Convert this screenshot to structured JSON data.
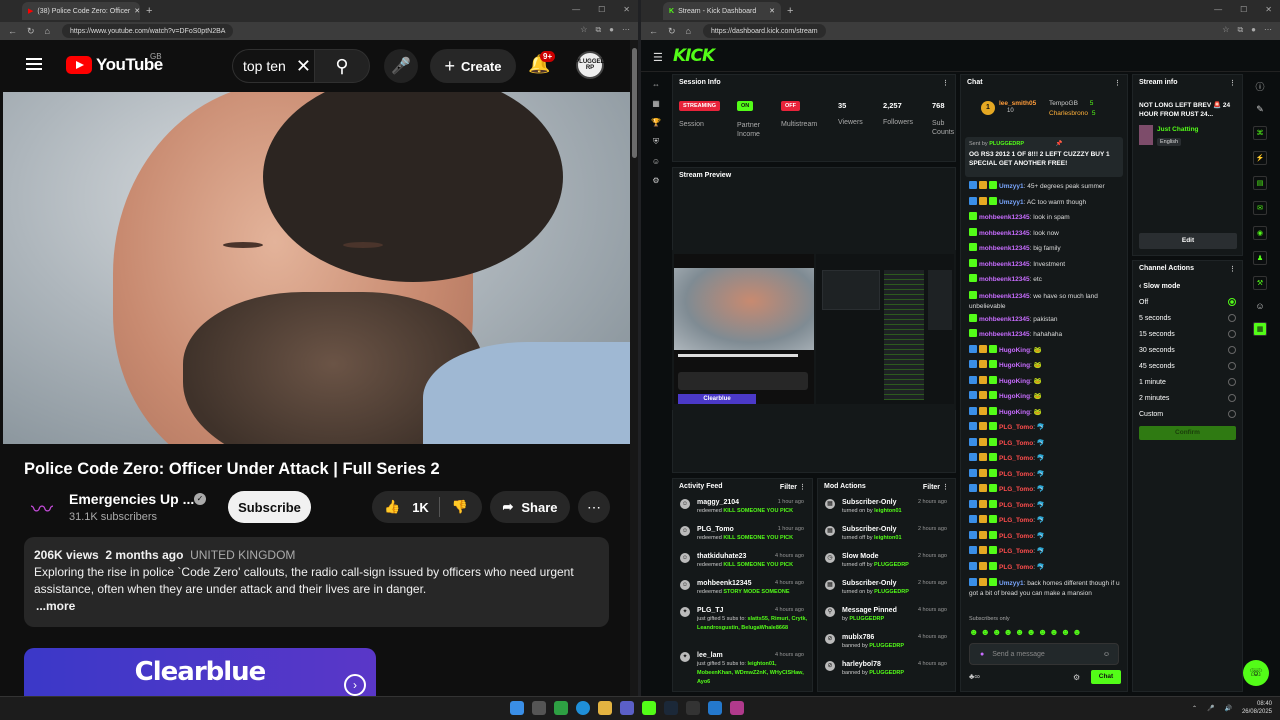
{
  "youtube": {
    "tab_title": "(38) Police Code Zero: Officer",
    "url": "https://www.youtube.com/watch?v=DFoS0ptN2BA",
    "logo": "YouTube",
    "region": "GB",
    "search_value": "top ten",
    "create_label": "Create",
    "notif_badge": "9+",
    "avatar_text": "PLUGGED RP",
    "video_title": "Police Code Zero: Officer Under Attack | Full Series 2",
    "channel_name": "Emergencies Up ...",
    "subscribers": "31.1K subscribers",
    "subscribe_label": "Subscribe",
    "likes": "1K",
    "share_label": "Share",
    "views": "206K views",
    "age": "2 months ago",
    "country": "UNITED KINGDOM",
    "description": "Exploring the rise in police `Code Zero' callouts, the radio call-sign issued by officers who need urgent assistance, often when they are under attack and their lives are in danger.",
    "more_label": "...more",
    "ad_brand": "Clearblue"
  },
  "kick": {
    "tab_title": "Stream - Kick Dashboard",
    "url": "https://dashboard.kick.com/stream",
    "logo": "KICK",
    "session": {
      "title": "Session Info",
      "stats": [
        {
          "value": "STREAMING",
          "label": "Session"
        },
        {
          "value": "ON",
          "label": "Partner Income"
        },
        {
          "value": "OFF",
          "label": "Multistream"
        },
        {
          "value": "35",
          "label": "Viewers"
        },
        {
          "value": "2,257",
          "label": "Followers"
        },
        {
          "value": "768",
          "label": "Sub Counts"
        }
      ]
    },
    "preview_title": "Stream Preview",
    "preview_ad": "Clearblue",
    "activity": {
      "title": "Activity Feed",
      "filter": "Filter",
      "items": [
        {
          "user": "maggy_2104",
          "time": "1 hour ago",
          "text": "redeemed",
          "hl": "KILL SOMEONE YOU PICK"
        },
        {
          "user": "PLG_Tomo",
          "time": "1 hour ago",
          "text": "redeemed",
          "hl": "KILL SOMEONE YOU PICK"
        },
        {
          "user": "thatkiduhate23",
          "time": "4 hours ago",
          "text": "redeemed",
          "hl": "KILL SOMEONE YOU PICK"
        },
        {
          "user": "mohbeenk12345",
          "time": "4 hours ago",
          "text": "redeemed",
          "hl": "STORY MODE SOMEONE"
        },
        {
          "user": "PLG_TJ",
          "time": "4 hours ago",
          "text": "just gifted 5 subs to:",
          "hl": "slatts55, Rimuri, Crytk, Leandrosgustin, BelugaWhale8668"
        },
        {
          "user": "lee_lam",
          "time": "4 hours ago",
          "text": "just gifted 5 subs to:",
          "hl": "leighton01, MobeenKhan, WDmwZ2nK, WHyCISHaw, Ayo6"
        }
      ]
    },
    "mod": {
      "title": "Mod Actions",
      "filter": "Filter",
      "items": [
        {
          "user": "Subscriber-Only",
          "time": "2 hours ago",
          "text": "turned on by",
          "hl": "leighton01"
        },
        {
          "user": "Subscriber-Only",
          "time": "2 hours ago",
          "text": "turned off by",
          "hl": "leighton01"
        },
        {
          "user": "Slow Mode",
          "time": "2 hours ago",
          "text": "turned off by",
          "hl": "PLUGGEDRP"
        },
        {
          "user": "Subscriber-Only",
          "time": "2 hours ago",
          "text": "turned on by",
          "hl": "PLUGGEDRP"
        },
        {
          "user": "Message Pinned",
          "time": "4 hours ago",
          "text": "by",
          "hl": "PLUGGEDRP"
        },
        {
          "user": "mublx786",
          "time": "4 hours ago",
          "text": "banned by",
          "hl": "PLUGGEDRP"
        },
        {
          "user": "harleybol78",
          "time": "4 hours ago",
          "text": "banned by",
          "hl": "PLUGGEDRP"
        }
      ]
    },
    "chat": {
      "title": "Chat",
      "top_user": "lee_smith05",
      "top_count": "10",
      "gifters": [
        {
          "name": "TempoGB",
          "count": "5"
        },
        {
          "name": "Charlesbrono",
          "count": "5"
        }
      ],
      "pinned_by": "Sent by",
      "pinned_user": "PLUGGEDRP",
      "pinned_msg": "OG RS3 2012 1 OF 8!!! 2 LEFT CUZZZY BUY 1 SPECIAL GET ANOTHER FREE!",
      "messages": [
        {
          "user": "Umzyy1",
          "msg": "45+ degrees peak summer",
          "color": "#7aa7ff"
        },
        {
          "user": "Umzyy1",
          "msg": "AC too warm though",
          "color": "#7aa7ff"
        },
        {
          "user": "mohbeenk12345",
          "msg": "look in spam",
          "color": "#c86cff"
        },
        {
          "user": "mohbeenk12345",
          "msg": "look now",
          "color": "#c86cff"
        },
        {
          "user": "mohbeenk12345",
          "msg": "big family",
          "color": "#c86cff"
        },
        {
          "user": "mohbeenk12345",
          "msg": "Investment",
          "color": "#c86cff"
        },
        {
          "user": "mohbeenk12345",
          "msg": "etc",
          "color": "#c86cff"
        },
        {
          "user": "mohbeenk12345",
          "msg": "we have so much land unbelievable",
          "color": "#c86cff"
        },
        {
          "user": "mohbeenk12345",
          "msg": "pakistan",
          "color": "#c86cff"
        },
        {
          "user": "mohbeenk12345",
          "msg": "hahahaha",
          "color": "#c86cff"
        },
        {
          "user": "HugoKing",
          "msg": "🐸",
          "color": "#c86cff"
        },
        {
          "user": "HugoKing",
          "msg": "🐸",
          "color": "#c86cff"
        },
        {
          "user": "HugoKing",
          "msg": "🐸",
          "color": "#c86cff"
        },
        {
          "user": "HugoKing",
          "msg": "🐸",
          "color": "#c86cff"
        },
        {
          "user": "HugoKing",
          "msg": "🐸",
          "color": "#c86cff"
        },
        {
          "user": "PLG_Tomo",
          "msg": "🐬",
          "color": "#ff4d4d"
        },
        {
          "user": "PLG_Tomo",
          "msg": "🐬",
          "color": "#ff4d4d"
        },
        {
          "user": "PLG_Tomo",
          "msg": "🐬",
          "color": "#ff4d4d"
        },
        {
          "user": "PLG_Tomo",
          "msg": "🐬",
          "color": "#ff4d4d"
        },
        {
          "user": "PLG_Tomo",
          "msg": "🐬",
          "color": "#ff4d4d"
        },
        {
          "user": "PLG_Tomo",
          "msg": "🐬",
          "color": "#ff4d4d"
        },
        {
          "user": "PLG_Tomo",
          "msg": "🐬",
          "color": "#ff4d4d"
        },
        {
          "user": "PLG_Tomo",
          "msg": "🐬",
          "color": "#ff4d4d"
        },
        {
          "user": "PLG_Tomo",
          "msg": "🐬",
          "color": "#ff4d4d"
        },
        {
          "user": "PLG_Tomo",
          "msg": "🐬",
          "color": "#ff4d4d"
        },
        {
          "user": "Umzyy1",
          "msg": "back homes different though if u got a bit of bread you can make a mansion",
          "color": "#7aa7ff"
        }
      ],
      "subs_only": "Subscribers only",
      "placeholder": "Send a message",
      "send_label": "Chat"
    },
    "stream_info": {
      "title": "Stream info",
      "stream_title": "NOT LONG LEFT BREV 🚨 24 HOUR FROM RUST 24...",
      "category": "Just Chatting",
      "language": "English",
      "edit_label": "Edit"
    },
    "channel_actions": {
      "title": "Channel Actions",
      "slow_mode": "Slow mode",
      "options": [
        "Off",
        "5 seconds",
        "15 seconds",
        "30 seconds",
        "45 seconds",
        "1 minute",
        "2 minutes",
        "Custom"
      ],
      "selected": "Off",
      "confirm_label": "Confirm"
    }
  },
  "taskbar": {
    "time": "08:40",
    "date": "26/08/2025"
  },
  "colors": {
    "kick_green": "#53fc18",
    "yt_red": "#ff0000",
    "streaming_red": "#e8233a"
  }
}
